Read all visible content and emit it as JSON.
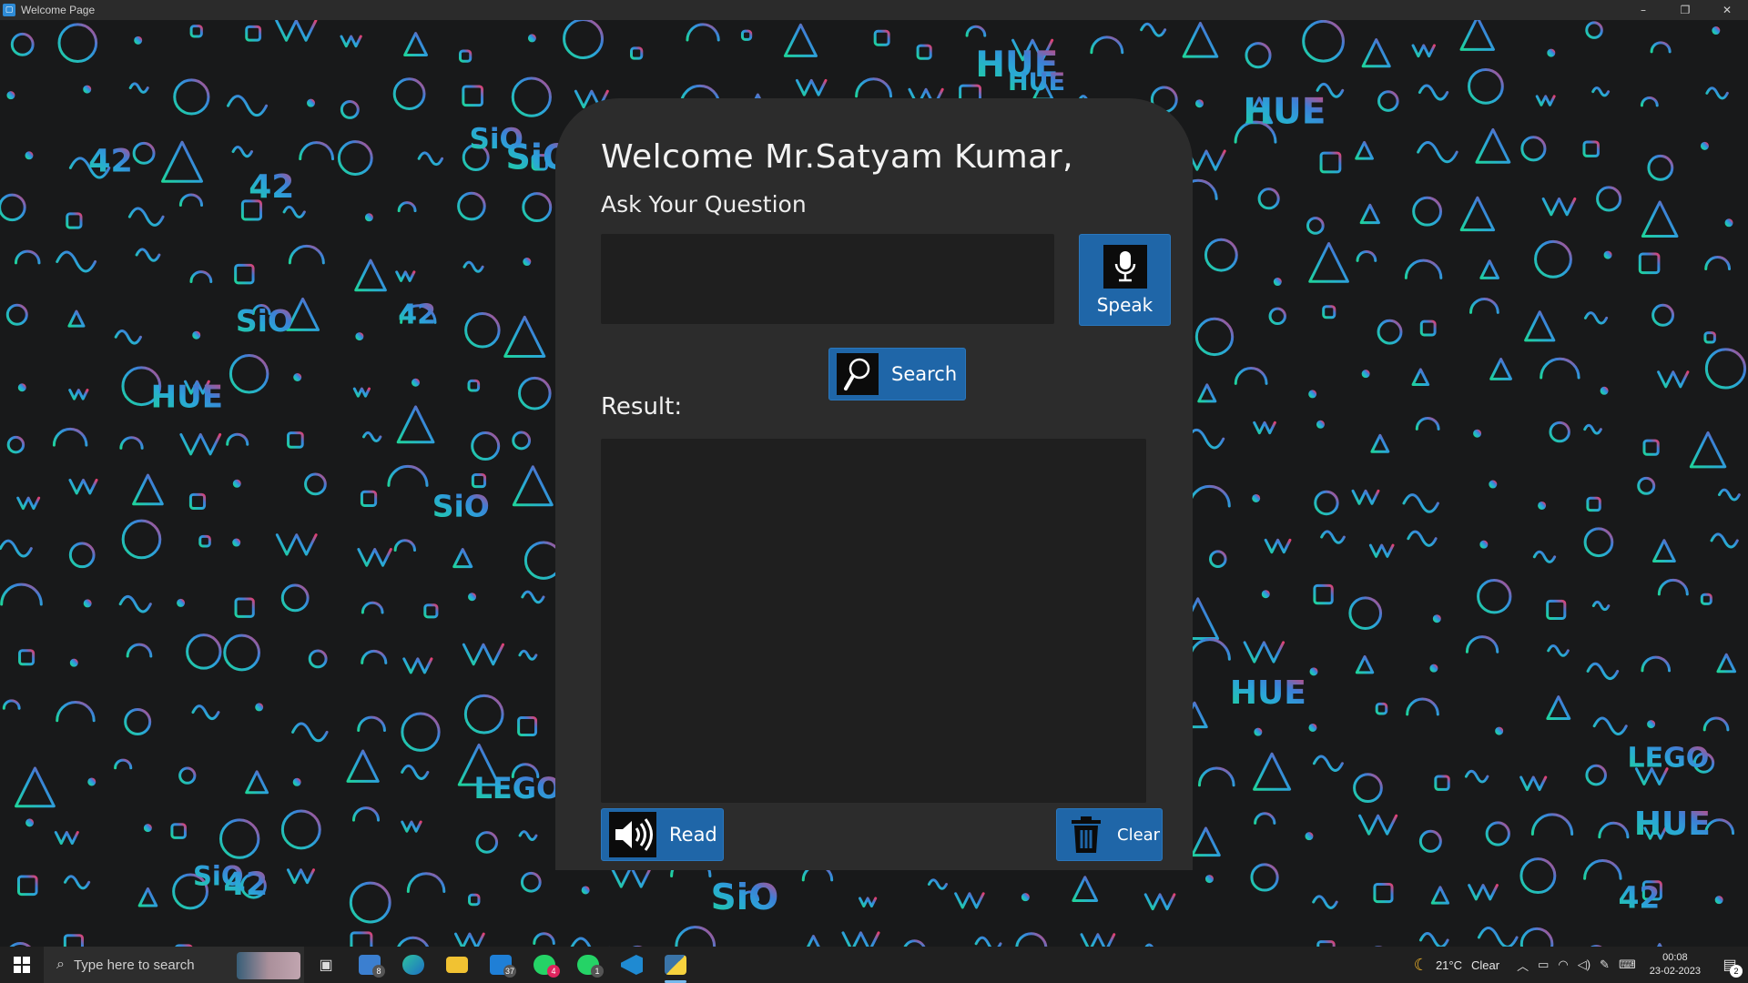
{
  "window": {
    "title": "Welcome Page",
    "controls": [
      "–",
      "❐",
      "✕"
    ]
  },
  "main": {
    "welcome": "Welcome Mr.Satyam Kumar,",
    "ask_label": "Ask Your Question",
    "question_value": "",
    "speak_label": "Speak",
    "search_label": "Search",
    "result_label": "Result:",
    "result_text": "",
    "read_label": "Read",
    "clear_label": "Clear"
  },
  "background": {
    "words": [
      "HUE",
      "SiO",
      "42",
      "LEGO",
      "HUE",
      "SiO",
      "42",
      "LEGO",
      "HUE",
      "SiO",
      "42",
      "HUE",
      "SiO"
    ],
    "colors": {
      "left": "#1fd39a",
      "mid": "#2aa6d8",
      "right": "#e23f71"
    }
  },
  "taskbar": {
    "search_placeholder": "Type here to search",
    "badges": {
      "mail": "8",
      "mail2": "37",
      "whatsapp": "4",
      "whatsapp2": "1"
    },
    "weather_temp": "21°C",
    "weather_text": "Clear",
    "time": "00:08",
    "date": "23-02-2023",
    "notifications": "2"
  }
}
